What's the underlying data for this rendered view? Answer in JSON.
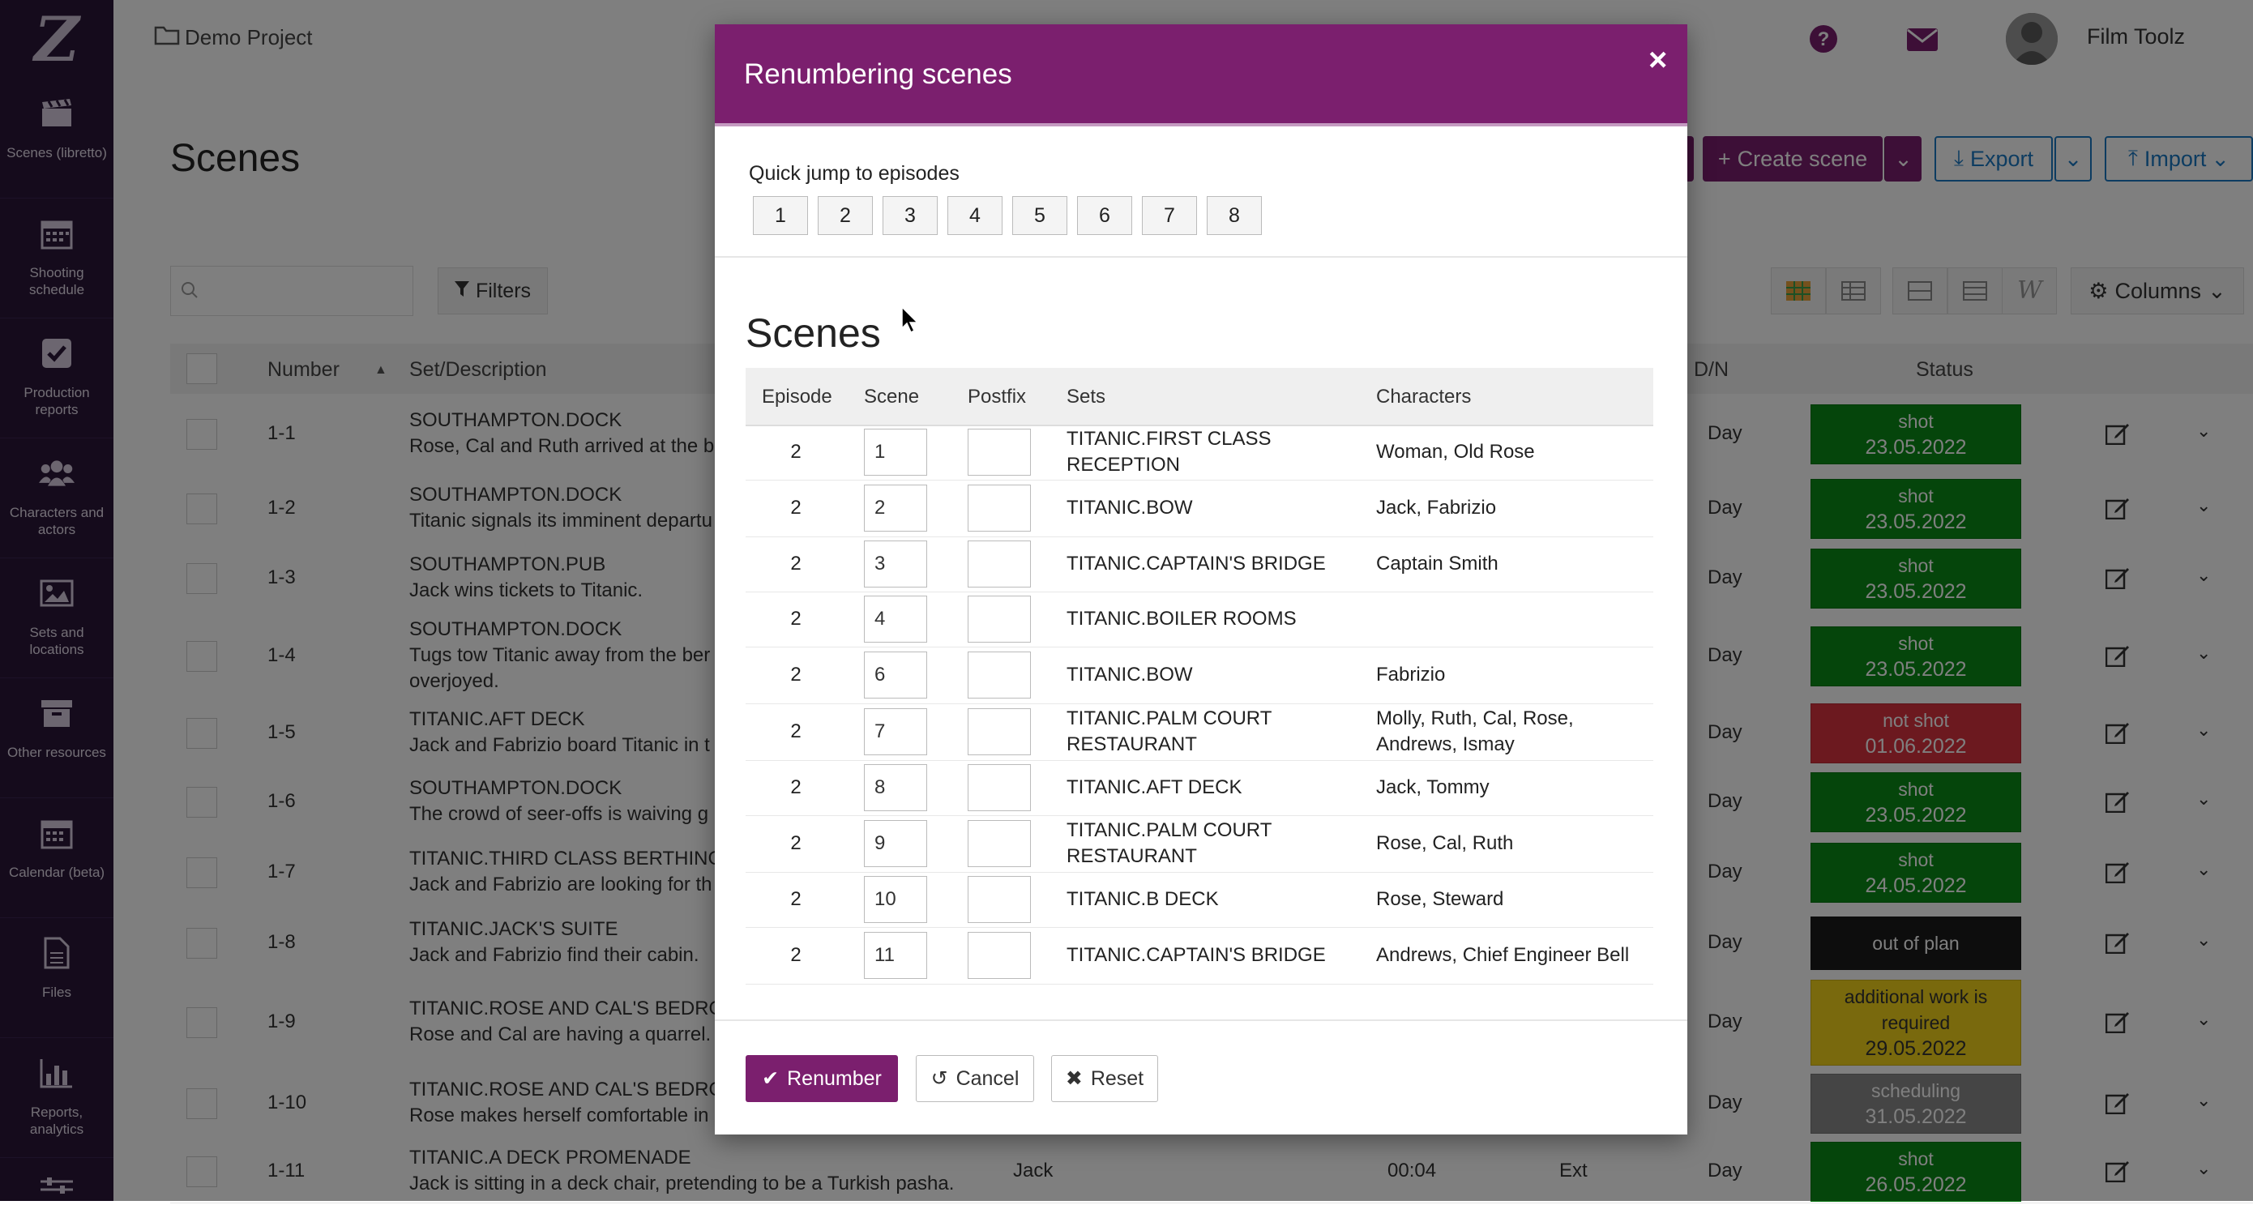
{
  "sidebar": {
    "logo": "Z",
    "items": [
      {
        "label": "Scenes (libretto)",
        "icon": "clapperboard-icon"
      },
      {
        "label": "Shooting schedule",
        "icon": "calendar-icon"
      },
      {
        "label": "Production reports",
        "icon": "checkbox-icon"
      },
      {
        "label": "Characters and actors",
        "icon": "users-icon"
      },
      {
        "label": "Sets and locations",
        "icon": "image-icon"
      },
      {
        "label": "Other resources",
        "icon": "archive-icon"
      },
      {
        "label": "Calendar (beta)",
        "icon": "calendar-grid-icon"
      },
      {
        "label": "Files",
        "icon": "file-icon"
      },
      {
        "label": "Reports, analytics",
        "icon": "bar-chart-icon"
      }
    ]
  },
  "topbar": {
    "project": "Demo Project",
    "user": "Film Toolz"
  },
  "page": {
    "title": "Scenes",
    "create_label": "Create scene",
    "export_label": "Export",
    "import_label": "Import",
    "filters_label": "Filters",
    "columns_label": "Columns",
    "search_placeholder": ""
  },
  "table": {
    "headers": {
      "number": "Number",
      "set": "Set/Description",
      "dn": "D/N",
      "status": "Status"
    },
    "rows": [
      {
        "num": "1-1",
        "set": "SOUTHAMPTON.DOCK",
        "desc": "Rose, Cal and Ruth arrived at the be",
        "dn": "Day",
        "status": "shot",
        "date": "23.05.2022",
        "color": "#0b8a17"
      },
      {
        "num": "1-2",
        "set": "SOUTHAMPTON.DOCK",
        "desc": "Titanic signals its imminent departu",
        "dn": "Day",
        "status": "shot",
        "date": "23.05.2022",
        "color": "#0b8a17"
      },
      {
        "num": "1-3",
        "set": "SOUTHAMPTON.PUB",
        "desc": "Jack wins tickets to Titanic.",
        "dn": "Day",
        "status": "shot",
        "date": "23.05.2022",
        "color": "#0b8a17"
      },
      {
        "num": "1-4",
        "set": "SOUTHAMPTON.DOCK",
        "desc": "Tugs tow Titanic away from the ber",
        "desc2": "overjoyed.",
        "dn": "Day",
        "status": "shot",
        "date": "23.05.2022",
        "color": "#0b8a17"
      },
      {
        "num": "1-5",
        "set": "TITANIC.AFT DECK",
        "desc": "Jack and Fabrizio board Titanic in t",
        "dn": "Day",
        "status": "not shot",
        "date": "01.06.2022",
        "color": "#d9333f"
      },
      {
        "num": "1-6",
        "set": "SOUTHAMPTON.DOCK",
        "desc": "The crowd of seer-offs is waiving g",
        "dn": "Day",
        "status": "shot",
        "date": "23.05.2022",
        "color": "#0b8a17"
      },
      {
        "num": "1-7",
        "set": "TITANIC.THIRD CLASS BERTHING",
        "desc": "Jack and Fabrizio are looking for th",
        "dn": "Day",
        "status": "shot",
        "date": "24.05.2022",
        "color": "#0b8a17"
      },
      {
        "num": "1-8",
        "set": "TITANIC.JACK'S SUITE",
        "desc": "Jack and Fabrizio find their cabin.",
        "dn": "Day",
        "status": "out of plan",
        "date": "",
        "color": "#1a1a1a"
      },
      {
        "num": "1-9",
        "set": "TITANIC.ROSE AND CAL'S BEDROO",
        "desc": "Rose and Cal are having a quarrel.",
        "dn": "Day",
        "status": "additional work is required",
        "date": "29.05.2022",
        "color": "#f2d21b"
      },
      {
        "num": "1-10",
        "set": "TITANIC.ROSE AND CAL'S BEDROO",
        "desc": "Rose makes herself comfortable in",
        "dn": "Day",
        "status": "scheduling",
        "date": "31.05.2022",
        "color": "#8a8a8a"
      },
      {
        "num": "1-11",
        "set": "TITANIC.A DECK PROMENADE",
        "desc": "Jack is sitting in a deck chair, pretending to be a Turkish pasha.",
        "char": "Jack",
        "time": "00:04",
        "ie": "Ext",
        "dn": "Day",
        "status": "shot",
        "date": "26.05.2022",
        "color": "#0b8a17"
      }
    ]
  },
  "modal": {
    "title": "Renumbering scenes",
    "close": "×",
    "quick_jump_label": "Quick jump to episodes",
    "episodes": [
      "1",
      "2",
      "3",
      "4",
      "5",
      "6",
      "7",
      "8"
    ],
    "scenes_heading": "Scenes",
    "headers": {
      "episode": "Episode",
      "scene": "Scene",
      "postfix": "Postfix",
      "sets": "Sets",
      "characters": "Characters"
    },
    "rows": [
      {
        "episode": "2",
        "scene": "1",
        "sets": "TITANIC.FIRST CLASS RECEPTION",
        "chars": "Woman, Old Rose"
      },
      {
        "episode": "2",
        "scene": "2",
        "sets": "TITANIC.BOW",
        "chars": "Jack, Fabrizio"
      },
      {
        "episode": "2",
        "scene": "3",
        "sets": "TITANIC.CAPTAIN'S BRIDGE",
        "chars": "Captain Smith"
      },
      {
        "episode": "2",
        "scene": "4",
        "sets": "TITANIC.BOILER ROOMS",
        "chars": ""
      },
      {
        "episode": "2",
        "scene": "6",
        "sets": "TITANIC.BOW",
        "chars": "Fabrizio"
      },
      {
        "episode": "2",
        "scene": "7",
        "sets": "TITANIC.PALM COURT RESTAURANT",
        "chars": "Molly, Ruth, Cal, Rose, Andrews, Ismay"
      },
      {
        "episode": "2",
        "scene": "8",
        "sets": "TITANIC.AFT DECK",
        "chars": "Jack, Tommy"
      },
      {
        "episode": "2",
        "scene": "9",
        "sets": "TITANIC.PALM COURT RESTAURANT",
        "chars": "Rose, Cal, Ruth"
      },
      {
        "episode": "2",
        "scene": "10",
        "sets": "TITANIC.B DECK",
        "chars": "Rose, Steward"
      },
      {
        "episode": "2",
        "scene": "11",
        "sets": "TITANIC.CAPTAIN'S BRIDGE",
        "chars": "Andrews, Chief Engineer Bell"
      }
    ],
    "renumber_label": "Renumber",
    "cancel_label": "Cancel",
    "reset_label": "Reset"
  }
}
